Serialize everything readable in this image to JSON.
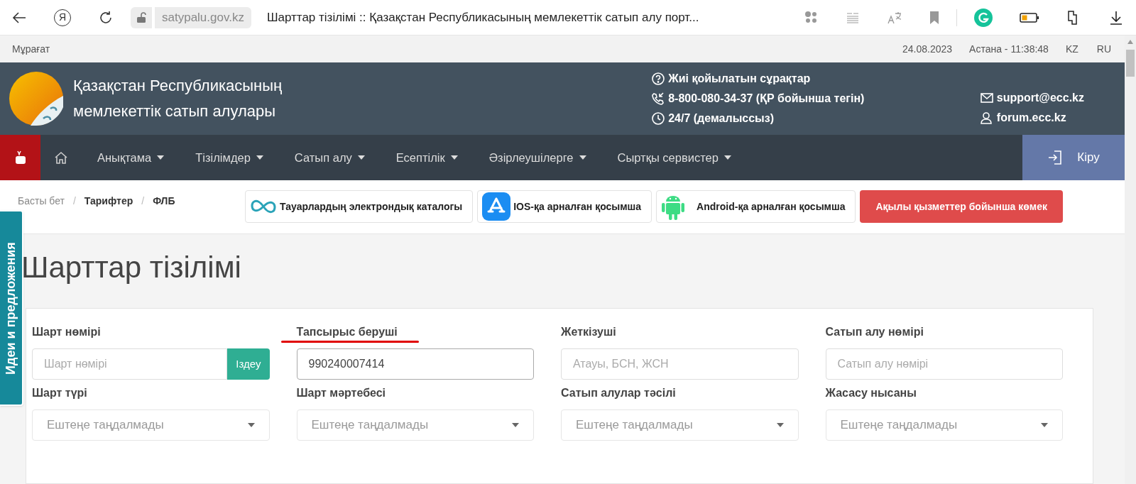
{
  "browser": {
    "yandex_glyph": "Я",
    "url": "satypalu.gov.kz",
    "tab_title": "Шарттар тізілімі :: Қазақстан Республикасының мемлекеттік сатып алу порт..."
  },
  "top_strip": {
    "archive": "Мұрағат",
    "date": "24.08.2023",
    "time": "Астана - 11:38:48",
    "languages": [
      "KZ",
      "RU"
    ]
  },
  "header": {
    "title_lines": [
      "Қазақстан Республикасының",
      "мемлекеттік сатып алулары"
    ],
    "contacts": [
      {
        "kind": "faq",
        "text": "Жиі қойылатын сұрақтар"
      },
      {
        "kind": "phone",
        "text": "8-800-080-34-37 (ҚР бойынша тегін)"
      },
      {
        "kind": "hours",
        "text": "24/7 (демалыссыз)"
      }
    ],
    "links": [
      {
        "kind": "email",
        "text": "support@ecc.kz"
      },
      {
        "kind": "forum",
        "text": "forum.ecc.kz"
      }
    ]
  },
  "nav": {
    "items": [
      {
        "label": "Анықтама",
        "dropdown": true
      },
      {
        "label": "Тізілімдер",
        "dropdown": true
      },
      {
        "label": "Сатып алу",
        "dropdown": true
      },
      {
        "label": "Есептілік",
        "dropdown": true
      },
      {
        "label": "Әзірлеушілерге",
        "dropdown": true
      },
      {
        "label": "Сыртқы сервистер",
        "dropdown": true
      }
    ],
    "login": "Кіру"
  },
  "breadcrumb_separator": "/",
  "breadcrumbs": [
    {
      "label": "Басты бет",
      "link": true
    },
    {
      "label": "Тарифтер",
      "link": false
    },
    {
      "label": "ФЛБ",
      "link": false
    }
  ],
  "app_buttons": [
    {
      "kind": "catalog",
      "label": "Тауарлардың электрондық каталогы"
    },
    {
      "kind": "ios",
      "label": "IOS-қа арналған қосымша"
    },
    {
      "kind": "android",
      "label": "Android-қа арналған қосымша"
    },
    {
      "kind": "help",
      "label": "Ақылы қызметтер бойынша көмек"
    }
  ],
  "side_tab": {
    "label": "Идеи и предложения"
  },
  "page_title": "Шарттар тізілімі",
  "filters": [
    {
      "kind": "search",
      "label": "Шарт нөмірі",
      "placeholder": "Шарт нөмірі",
      "button": "Іздеу",
      "highlighted": false
    },
    {
      "kind": "text",
      "label": "Тапсырыс беруші",
      "value": "990240007414",
      "highlighted": true
    },
    {
      "kind": "text",
      "label": "Жеткізуші",
      "placeholder": "Атауы, БСН, ЖСН",
      "highlighted": false
    },
    {
      "kind": "text",
      "label": "Сатып алу нөмірі",
      "placeholder": "Сатып алу нөмірі",
      "highlighted": false
    },
    {
      "kind": "select",
      "label": "Шарт түрі",
      "placeholder": "Ештеңе таңдалмады",
      "highlighted": false
    },
    {
      "kind": "select",
      "label": "Шарт мәртебесі",
      "placeholder": "Ештеңе таңдалмады",
      "highlighted": false
    },
    {
      "kind": "select",
      "label": "Сатып алулар тәсілі",
      "placeholder": "Ештеңе таңдалмады",
      "highlighted": false
    },
    {
      "kind": "select",
      "label": "Жасасу нысаны",
      "placeholder": "Ештеңе таңдалмады",
      "highlighted": false
    }
  ]
}
